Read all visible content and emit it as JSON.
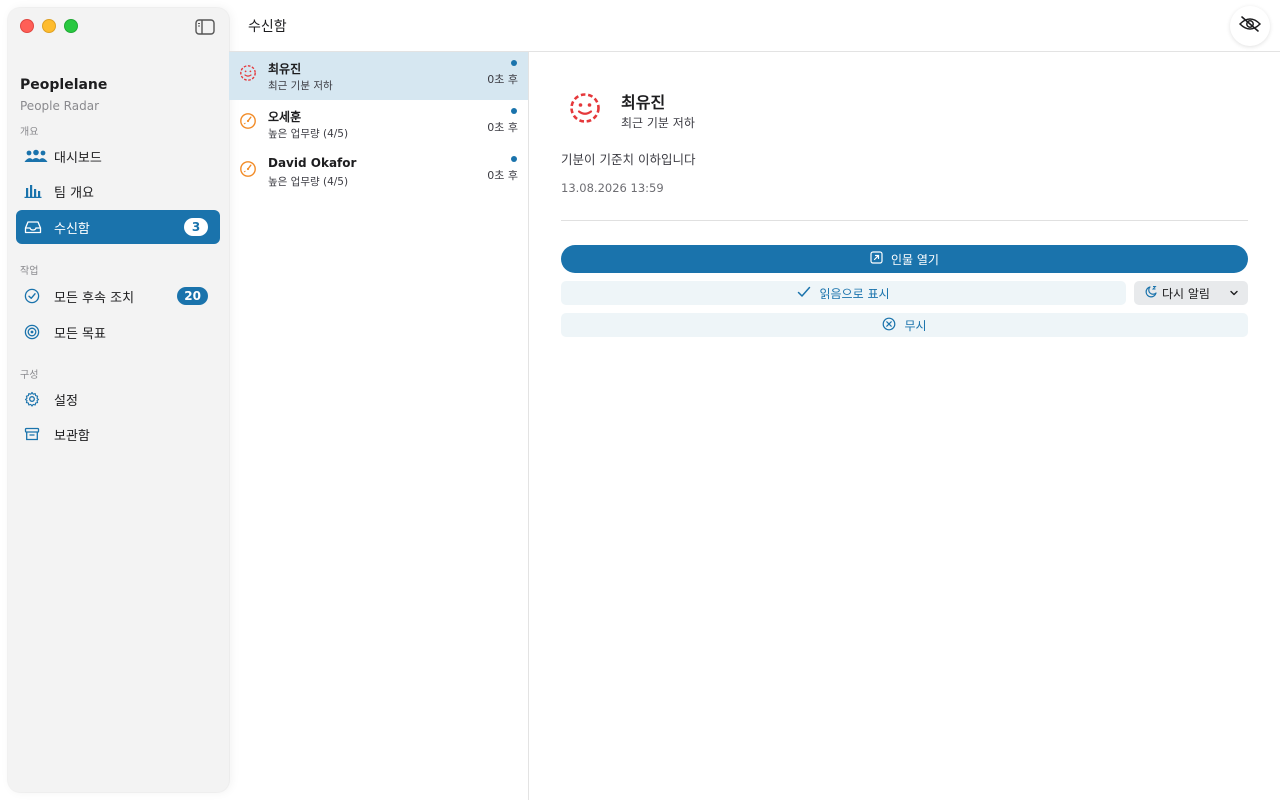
{
  "window": {
    "title": "수신함"
  },
  "sidebar": {
    "app_name": "Peoplelane",
    "app_subtitle": "People Radar",
    "sections": [
      {
        "label": "개요"
      },
      {
        "label": "작업"
      },
      {
        "label": "구성"
      }
    ],
    "items": [
      {
        "label": "대시보드",
        "icon": "people-icon"
      },
      {
        "label": "팀 개요",
        "icon": "chart-bars-icon"
      },
      {
        "label": "수신함",
        "icon": "inbox-icon",
        "badge": "3",
        "active": true
      },
      {
        "label": "모든 후속 조치",
        "icon": "check-circle-icon",
        "badge": "20"
      },
      {
        "label": "모든 목표",
        "icon": "target-icon"
      },
      {
        "label": "설정",
        "icon": "gear-icon"
      },
      {
        "label": "보관함",
        "icon": "archive-icon"
      }
    ]
  },
  "inbox": {
    "items": [
      {
        "name": "최유진",
        "subtitle": "최근 기분 저하",
        "time": "0초 후",
        "icon": "mood-face-icon",
        "color": "#e5383b",
        "unread": true,
        "selected": true
      },
      {
        "name": "오세훈",
        "subtitle": "높은 업무량 (4/5)",
        "time": "0초 후",
        "icon": "gauge-icon",
        "color": "#f28c28",
        "unread": true
      },
      {
        "name": "David Okafor",
        "subtitle": "높은 업무량 (4/5)",
        "time": "0초 후",
        "icon": "gauge-icon",
        "color": "#f28c28",
        "unread": true
      }
    ]
  },
  "detail": {
    "name": "최유진",
    "subtitle": "최근 기분 저하",
    "message": "기분이 기준치 이하입니다",
    "date": "13.08.2026 13:59",
    "buttons": {
      "open_person": "인물 열기",
      "mark_read": "읽음으로 표시",
      "snooze": "다시 알림",
      "ignore": "무시"
    }
  },
  "colors": {
    "accent": "#1a73ac",
    "alert_red": "#e5383b",
    "alert_orange": "#f28c28"
  }
}
